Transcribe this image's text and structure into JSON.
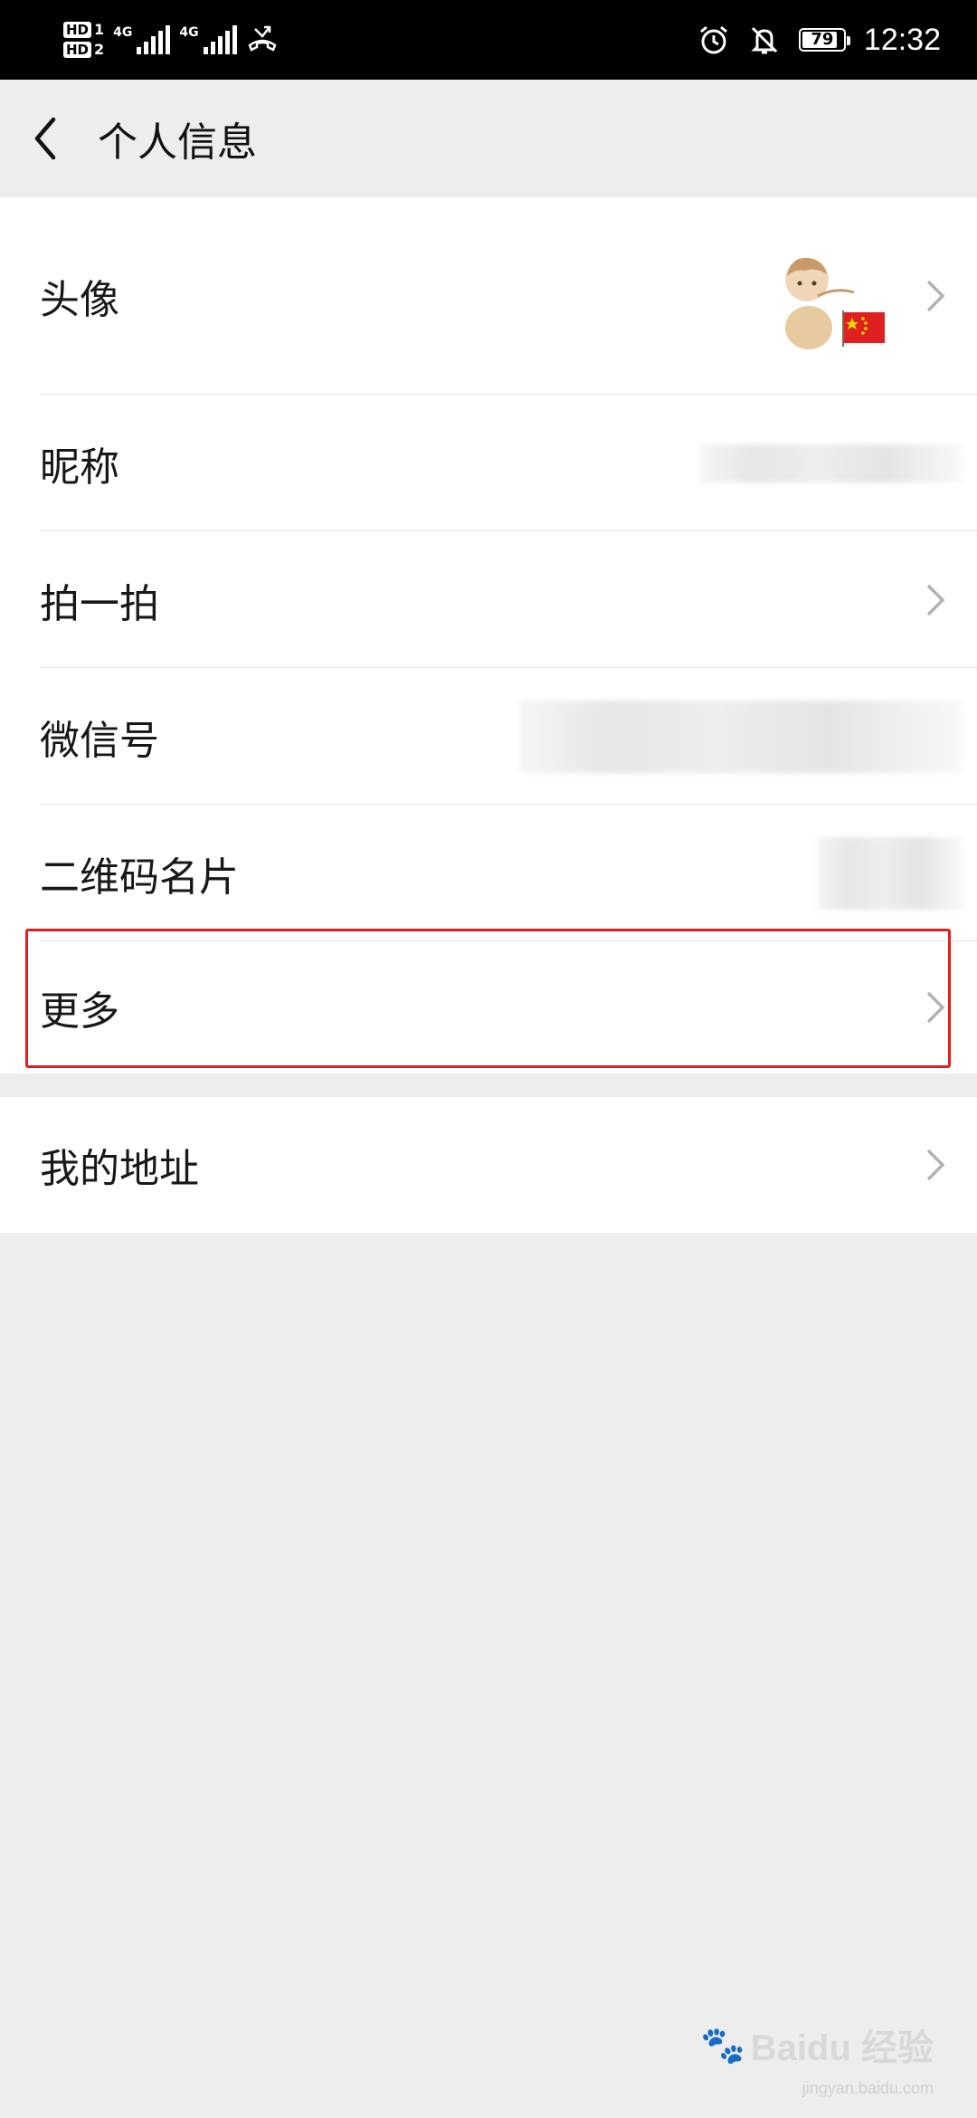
{
  "status_bar": {
    "hd1": "HD",
    "hd1_sub": "1",
    "hd2": "HD",
    "hd2_sub": "2",
    "net1": "4G",
    "net2": "4G",
    "battery": "79",
    "time": "12:32",
    "icons": [
      "alarm-icon",
      "mute-icon",
      "missed-call-icon"
    ]
  },
  "header": {
    "title": "个人信息"
  },
  "rows": [
    {
      "label": "头像"
    },
    {
      "label": "昵称"
    },
    {
      "label": "拍一拍"
    },
    {
      "label": "微信号"
    },
    {
      "label": "二维码名片"
    },
    {
      "label": "更多"
    }
  ],
  "address": {
    "label": "我的地址"
  },
  "watermark": {
    "text": "Baidu 经验",
    "url": "jingyan.baidu.com"
  },
  "colors": {
    "highlight": "#e51c1c",
    "background": "#ededed"
  }
}
